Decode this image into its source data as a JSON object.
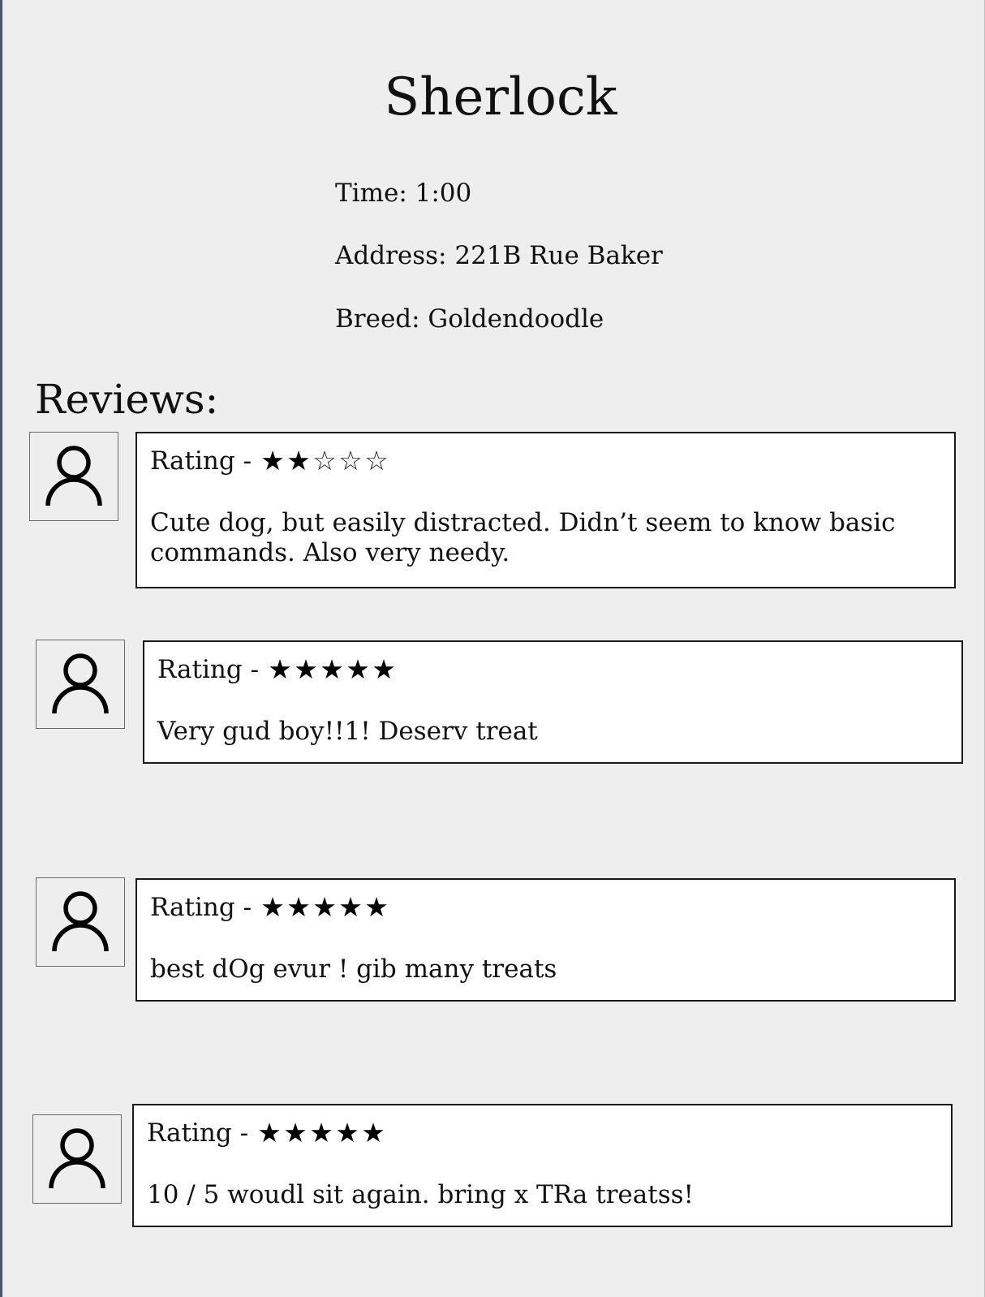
{
  "dog": {
    "name": "Sherlock",
    "time": "Time: 1:00",
    "address": "Address: 221B Rue Baker",
    "breed": "Breed: Goldendoodle"
  },
  "reviews_heading": "Reviews:",
  "reviews": [
    {
      "rating_label": "Rating -",
      "stars": 2,
      "max_stars": 5,
      "text": "Cute dog, but easily distracted. Didn’t seem to know basic commands. Also very needy.",
      "avatar_icon": "user-icon"
    },
    {
      "rating_label": "Rating -",
      "stars": 5,
      "max_stars": 5,
      "text": "Very gud boy!!1! Deserv treat",
      "avatar_icon": "user-icon"
    },
    {
      "rating_label": "Rating -",
      "stars": 5,
      "max_stars": 5,
      "text": "best dOg evur !  gib many treats",
      "avatar_icon": "user-icon"
    },
    {
      "rating_label": "Rating -",
      "stars": 5,
      "max_stars": 5,
      "text": "10 / 5 woudl sit again. bring x TRa treatss!",
      "avatar_icon": "user-icon"
    }
  ],
  "colors": {
    "background": "#eeeeee",
    "card": "#ffffff",
    "border": "#1a1a1a",
    "text": "#111111"
  }
}
